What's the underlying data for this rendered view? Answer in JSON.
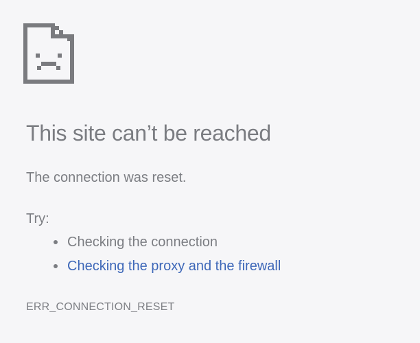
{
  "error": {
    "icon": "sad-page-icon",
    "title": "This site can’t be reached",
    "message": "The connection was reset.",
    "try_label": "Try:",
    "suggestions": [
      {
        "text": "Checking the connection",
        "is_link": false
      },
      {
        "text": "Checking the proxy and the firewall",
        "is_link": true
      }
    ],
    "code": "ERR_CONNECTION_RESET"
  },
  "colors": {
    "background": "#f6f6f8",
    "text": "#7b7d82",
    "link": "#3d67b8",
    "icon": "#7a7b7f"
  }
}
